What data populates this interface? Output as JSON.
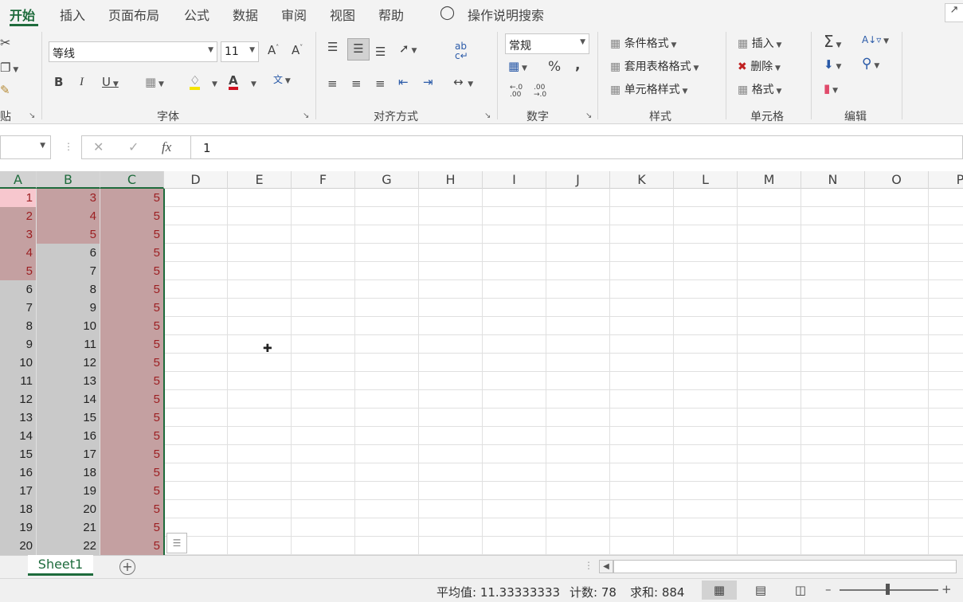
{
  "tabs": [
    "开始",
    "插入",
    "页面布局",
    "公式",
    "数据",
    "审阅",
    "视图",
    "帮助"
  ],
  "tell_me": "操作说明搜索",
  "font": {
    "name": "等线",
    "size": "11"
  },
  "number_format": "常规",
  "styles": {
    "conditional": "条件格式",
    "table": "套用表格格式",
    "cell": "单元格样式"
  },
  "cells_group": {
    "insert": "插入",
    "delete": "删除",
    "format": "格式"
  },
  "group_labels": {
    "font": "字体",
    "alignment": "对齐方式",
    "number": "数字",
    "styles": "样式",
    "cells": "单元格",
    "editing": "编辑",
    "clipboard": "贴"
  },
  "formula": {
    "value": "1",
    "fx": "fx"
  },
  "columns": [
    "A",
    "B",
    "C",
    "D",
    "E",
    "F",
    "G",
    "H",
    "I",
    "J",
    "K",
    "L",
    "M",
    "N",
    "O",
    "P"
  ],
  "rows": [
    {
      "a": "1",
      "b": "3",
      "c": "5"
    },
    {
      "a": "2",
      "b": "4",
      "c": "5"
    },
    {
      "a": "3",
      "b": "5",
      "c": "5"
    },
    {
      "a": "4",
      "b": "6",
      "c": "5"
    },
    {
      "a": "5",
      "b": "7",
      "c": "5"
    },
    {
      "a": "6",
      "b": "8",
      "c": "5"
    },
    {
      "a": "7",
      "b": "9",
      "c": "5"
    },
    {
      "a": "8",
      "b": "10",
      "c": "5"
    },
    {
      "a": "9",
      "b": "11",
      "c": "5"
    },
    {
      "a": "10",
      "b": "12",
      "c": "5"
    },
    {
      "a": "11",
      "b": "13",
      "c": "5"
    },
    {
      "a": "12",
      "b": "14",
      "c": "5"
    },
    {
      "a": "13",
      "b": "15",
      "c": "5"
    },
    {
      "a": "14",
      "b": "16",
      "c": "5"
    },
    {
      "a": "15",
      "b": "17",
      "c": "5"
    },
    {
      "a": "16",
      "b": "18",
      "c": "5"
    },
    {
      "a": "17",
      "b": "19",
      "c": "5"
    },
    {
      "a": "18",
      "b": "20",
      "c": "5"
    },
    {
      "a": "19",
      "b": "21",
      "c": "5"
    },
    {
      "a": "20",
      "b": "22",
      "c": "5"
    }
  ],
  "sheet": {
    "name": "Sheet1"
  },
  "status": {
    "average": "平均值: 11.33333333",
    "count": "计数: 78",
    "sum": "求和: 884"
  },
  "colors": {
    "accent": "#1e6b3c",
    "dup_fill": "#c4a0a1",
    "dup_text": "#9c1f22"
  }
}
